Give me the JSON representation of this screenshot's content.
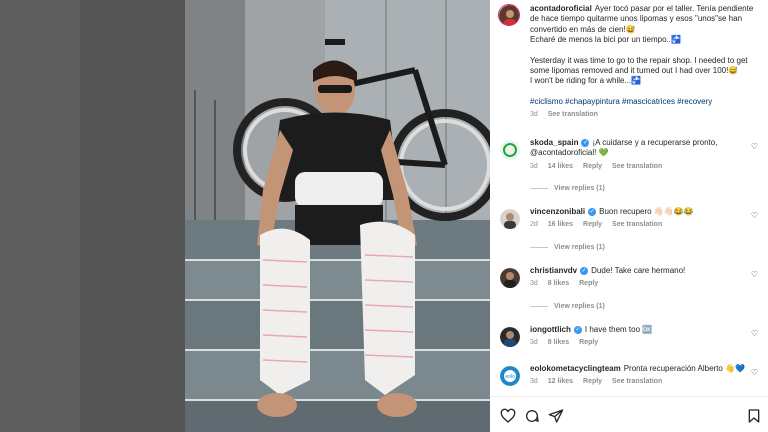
{
  "post": {
    "username": "acontadoroficial",
    "caption_es": "Ayer tocó pasar por el taller. Tenía pendiente de hace tiempo quitarme unos lipomas y esos \"unos\"se han convertido en más de cien!😅",
    "caption_es2": "Echaré de menos la bici por un tiempo..🚰",
    "caption_en": "Yesterday it was time to go to the repair shop. I needed to get some lipomas removed and it turned out I had over 100!😅",
    "caption_en2": "I won't be riding for a while...🚰",
    "hashtags": "#ciclismo #chapaypintura #mascicatrices #recovery",
    "time": "3d",
    "see_translation": "See translation"
  },
  "comments": [
    {
      "username": "skoda_spain",
      "verified": true,
      "text": "¡A cuidarse y a recuperarse pronto, @acontadoroficial! 💚",
      "time": "3d",
      "likes": "14 likes",
      "reply": "Reply",
      "translation": "See translation",
      "view_replies": "View replies (1)"
    },
    {
      "username": "vincenzonibali",
      "verified": true,
      "text": "Buon recupero 👋🏻👋🏻😂😂",
      "time": "2d",
      "likes": "16 likes",
      "reply": "Reply",
      "translation": "See translation",
      "view_replies": "View replies (1)"
    },
    {
      "username": "christianvdv",
      "verified": true,
      "text": "Dude! Take care hermano!",
      "time": "3d",
      "likes": "8 likes",
      "reply": "Reply",
      "translation": "",
      "view_replies": "View replies (1)"
    },
    {
      "username": "iongottlich",
      "verified": true,
      "text": "I have them too 🆗",
      "time": "3d",
      "likes": "8 likes",
      "reply": "Reply",
      "translation": "",
      "view_replies": ""
    },
    {
      "username": "eolokometacyclingteam",
      "verified": false,
      "text": "Pronta recuperación Alberto 👋💙",
      "time": "3d",
      "likes": "12 likes",
      "reply": "Reply",
      "translation": "See translation",
      "view_replies": ""
    }
  ],
  "icons": {
    "like": "heart-icon",
    "comment": "comment-icon",
    "share": "share-icon",
    "save": "bookmark-icon"
  },
  "colors": {
    "accent_link": "#00376b",
    "verified": "#3897f0",
    "muted": "#8e8e8e"
  }
}
